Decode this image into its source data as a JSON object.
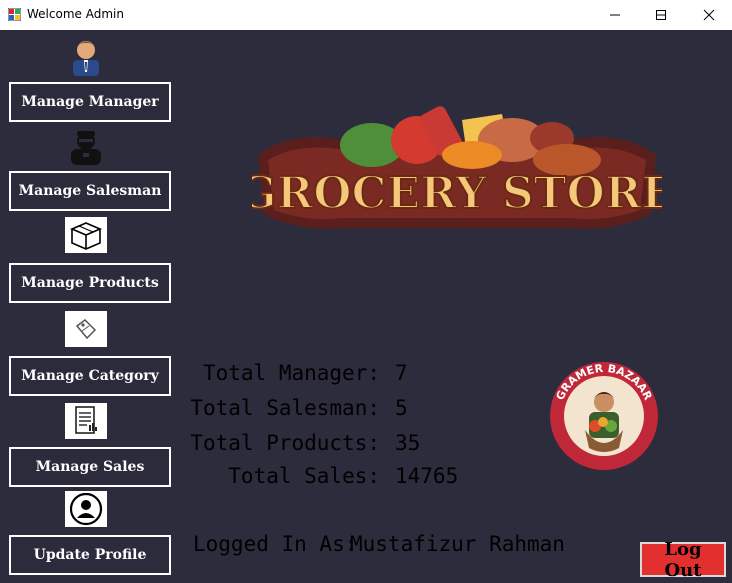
{
  "window": {
    "title": "Welcome Admin"
  },
  "logo": {
    "main": "GROCERY STORE"
  },
  "badge": {
    "text": "GRAMER BAZAAR"
  },
  "nav": {
    "manage_manager": "Manage Manager",
    "manage_salesman": "Manage Salesman",
    "manage_products": "Manage Products",
    "manage_category": "Manage Category",
    "manage_sales": "Manage Sales",
    "update_profile": "Update Profile"
  },
  "icons": [
    "manager-person-icon",
    "salesman-icon",
    "product-box-icon",
    "category-tag-icon",
    "sales-document-icon",
    "profile-user-icon"
  ],
  "stats": {
    "manager_label": "Total Manager:",
    "manager_value": "7",
    "salesman_label": "Total Salesman:",
    "salesman_value": "5",
    "products_label": "Total Products:",
    "products_value": "35",
    "sales_label": "Total Sales:",
    "sales_value": "14765"
  },
  "logged_in": {
    "label": "Logged In As:",
    "name": "Mustafizur Rahman"
  },
  "logout": {
    "label": "Log Out"
  },
  "colors": {
    "background": "#2d2c3d",
    "logout_bg": "#e3302f",
    "logo_text": "#f5c77a",
    "badge": "#c0283a"
  }
}
